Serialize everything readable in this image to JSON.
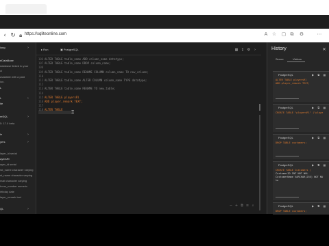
{
  "browser": {
    "url": "https://sqliteonline.com"
  },
  "sidebar": {
    "items": [
      {
        "text": "long",
        "dim": false
      },
      {
        "text": "eDataBase",
        "dim": false
      },
      {
        "text": "database linked to your",
        "dim": true
      },
      {
        "text": "ol",
        "dim": true
      },
      {
        "text": "available with a paid",
        "dim": true
      },
      {
        "text": "ion.",
        "dim": true
      },
      {
        "text": "L",
        "dim": false
      },
      {
        "text": "L",
        "dim": false
      },
      {
        "text": "ite",
        "dim": false
      },
      {
        "text": "reSQL",
        "dim": false
      },
      {
        "text": "5: 17.0 beta",
        "dim": true
      },
      {
        "text": "le",
        "dim": false
      },
      {
        "text": "yers",
        "dim": false
      },
      {
        "text": "layer_id serial",
        "dim": true
      },
      {
        "text": "ayersRl",
        "dim": false
      },
      {
        "text": "ayer_id serial",
        "dim": true
      },
      {
        "text": "rst_name character varying",
        "dim": true
      },
      {
        "text": "st_name character varying",
        "dim": true
      },
      {
        "text": "mail character varying",
        "dim": true
      },
      {
        "text": "hone_number numeric",
        "dim": true
      },
      {
        "text": "irthday date",
        "dim": true
      },
      {
        "text": "layer_remark text",
        "dim": true
      },
      {
        "text": "QL",
        "dim": false
      }
    ]
  },
  "editor": {
    "run_label": "Run",
    "tab_label": "PostgreSQL",
    "lines": [
      {
        "n": "106",
        "code": "ALTER TABLE table_name ADD column_name datatype;",
        "hl": false
      },
      {
        "n": "107",
        "code": "ALTER TABLE table_name DROP column_name;",
        "hl": false
      },
      {
        "n": "108",
        "code": "",
        "hl": false
      },
      {
        "n": "109",
        "code": "ALTER TABLE table_name RENAME COLUMN column_name TO new_column;",
        "hl": false
      },
      {
        "n": "110",
        "code": "",
        "hl": false
      },
      {
        "n": "111",
        "code": "ALTER TABLE table_name ALTER COLUMN column_name TYPE datatype;",
        "hl": false
      },
      {
        "n": "112",
        "code": "",
        "hl": false
      },
      {
        "n": "113",
        "code": "ALTER TABLE table_name RENAME TO new_table;",
        "hl": false
      },
      {
        "n": "114",
        "code": "",
        "hl": false
      },
      {
        "n": "115",
        "code": "ALTER TABLE playersRl",
        "hl": true
      },
      {
        "n": "116",
        "code": "ADD player_remark TEXT;",
        "hl": true
      },
      {
        "n": "117",
        "code": "",
        "hl": false
      },
      {
        "n": "118",
        "code": "ALTER TABLE",
        "hl": true
      }
    ]
  },
  "history": {
    "title": "History",
    "tabs": [
      "Server",
      "Visitors"
    ],
    "cards": [
      {
        "title": "PostgreSQL",
        "lines": [
          "ALTER TABLE playersRl",
          "ADD player_remark TEXT;"
        ]
      },
      {
        "title": "PostgreSQL",
        "lines": [
          "CREATE TABLE \"playersRl\" (\"playe"
        ]
      },
      {
        "title": "PostgreSQL",
        "lines": [
          "DROP TABLE customers;"
        ]
      },
      {
        "title": "PostgreSQL",
        "lines": [
          "CREATE TABLE Customers (",
          "  CustomerID INT NOT NUL",
          "  CustomerName VARCHAR(255) NOT NU",
          "  ta"
        ]
      },
      {
        "title": "PostgreSQL",
        "lines": [
          "DROP TABLE customers;"
        ]
      }
    ]
  }
}
